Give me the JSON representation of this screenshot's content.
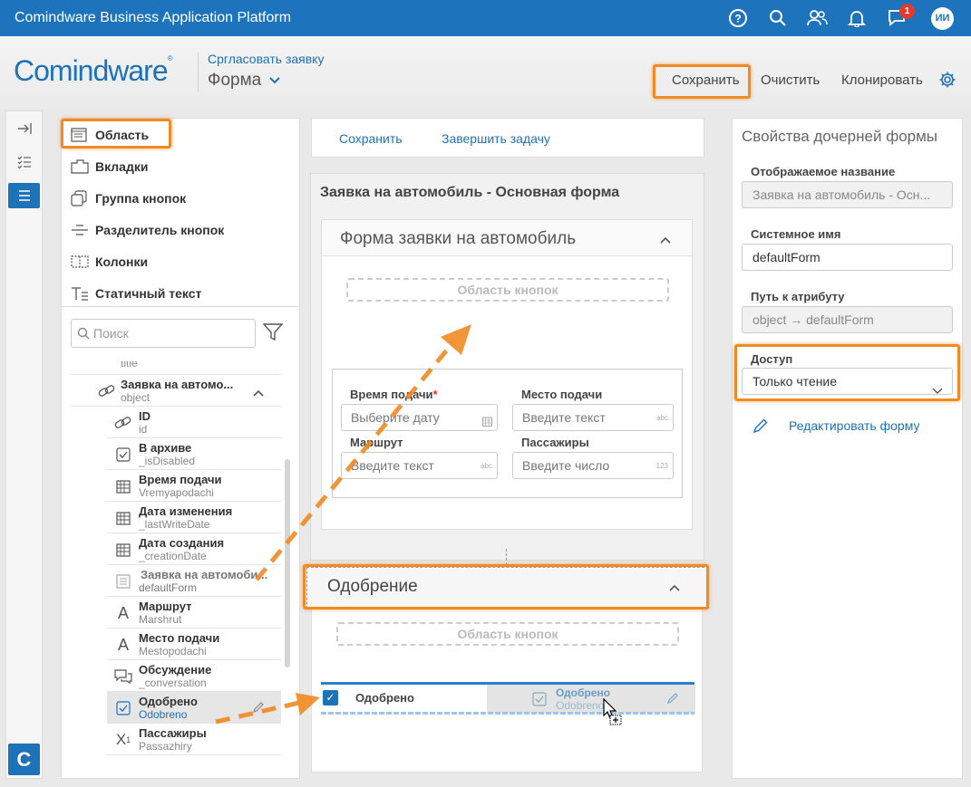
{
  "app": {
    "title": "Comindware Business Application Platform",
    "notification_count": "1",
    "avatar_initials": "ИИ",
    "accent": "#1d74bd",
    "highlight": "#f08a24"
  },
  "header": {
    "logo": "Comindware",
    "logo_mark": "®",
    "breadcrumb": "Срглaсовать заявку",
    "form_selector": "Форма",
    "buttons": {
      "save": "Сохранить",
      "clear": "Очистить",
      "clone": "Клонировать"
    }
  },
  "rail": {
    "logo_letter": "C"
  },
  "toolbox": {
    "tools": [
      {
        "label": "Область",
        "icon": "area-icon"
      },
      {
        "label": "Вкладки",
        "icon": "tabs-icon"
      },
      {
        "label": "Группа кнопок",
        "icon": "button-group-icon"
      },
      {
        "label": "Разделитель кнопок",
        "icon": "button-separator-icon"
      },
      {
        "label": "Колонки",
        "icon": "columns-icon"
      },
      {
        "label": "Статичный текст",
        "icon": "static-text-icon"
      }
    ],
    "search_placeholder": "Поиск",
    "tree": [
      {
        "label": "",
        "sub": "title",
        "icon": "link-icon"
      },
      {
        "label": "Заявка на автомо...",
        "sub": "object",
        "icon": "link-icon"
      },
      {
        "label": "ID",
        "sub": "id",
        "icon": "link-icon"
      },
      {
        "label": "В архиве",
        "sub": "_isDisabled",
        "icon": "checkbox-icon"
      },
      {
        "label": "Время подачи",
        "sub": "Vremyapodachi",
        "icon": "calendar-icon"
      },
      {
        "label": "Дата изменения",
        "sub": "_lastWriteDate",
        "icon": "calendar-icon"
      },
      {
        "label": "Дата создания",
        "sub": "_creationDate",
        "icon": "calendar-icon"
      },
      {
        "label": "Заявка на автомоби...",
        "sub": "defaultForm",
        "icon": "form-icon"
      },
      {
        "label": "Маршрут",
        "sub": "Marshrut",
        "icon": "text-icon"
      },
      {
        "label": "Место подачи",
        "sub": "Mestopodachi",
        "icon": "text-icon"
      },
      {
        "label": "Обсуждение",
        "sub": "_conversation",
        "icon": "chat-icon"
      },
      {
        "label": "Одобрено",
        "sub": "Odobreno",
        "icon": "checkbox-icon"
      },
      {
        "label": "Пассажиры",
        "sub": "Passazhiry",
        "icon": "number-icon"
      }
    ]
  },
  "canvas": {
    "action_bar": {
      "save": "Сохранить",
      "complete": "Завершить задачу"
    },
    "main_title": "Заявка на автомобиль - Основная форма",
    "section1": {
      "title": "Форма заявки на автомобиль",
      "button_area": "Область кнопок",
      "fields": [
        {
          "label": "Время подачи",
          "required": "*",
          "placeholder": "Выберите дату",
          "suffix": ""
        },
        {
          "label": "Место подачи",
          "required": "",
          "placeholder": "Введите текст",
          "suffix": "abc"
        },
        {
          "label": "Маршрут",
          "required": "",
          "placeholder": "Введите текст",
          "suffix": "abc"
        },
        {
          "label": "Пассажиры",
          "required": "",
          "placeholder": "Введите число",
          "suffix": "123"
        }
      ]
    },
    "section2": {
      "title": "Одобрение",
      "button_area": "Область кнопок",
      "dropped_field": "Одобрено",
      "ghost_label": "Одобрено",
      "ghost_sub": "Odobreno"
    }
  },
  "properties": {
    "title": "Свойства дочерней формы",
    "display_name_label": "Отображаемое название",
    "display_name_value": "Заявка на автомобиль - Осн...",
    "system_name_label": "Системное имя",
    "system_name_value": "defaultForm",
    "path_label": "Путь к атрибуту",
    "path_value": "object → defaultForm",
    "access_label": "Доступ",
    "access_value": "Только чтение",
    "edit_form": "Редактировать форму"
  }
}
